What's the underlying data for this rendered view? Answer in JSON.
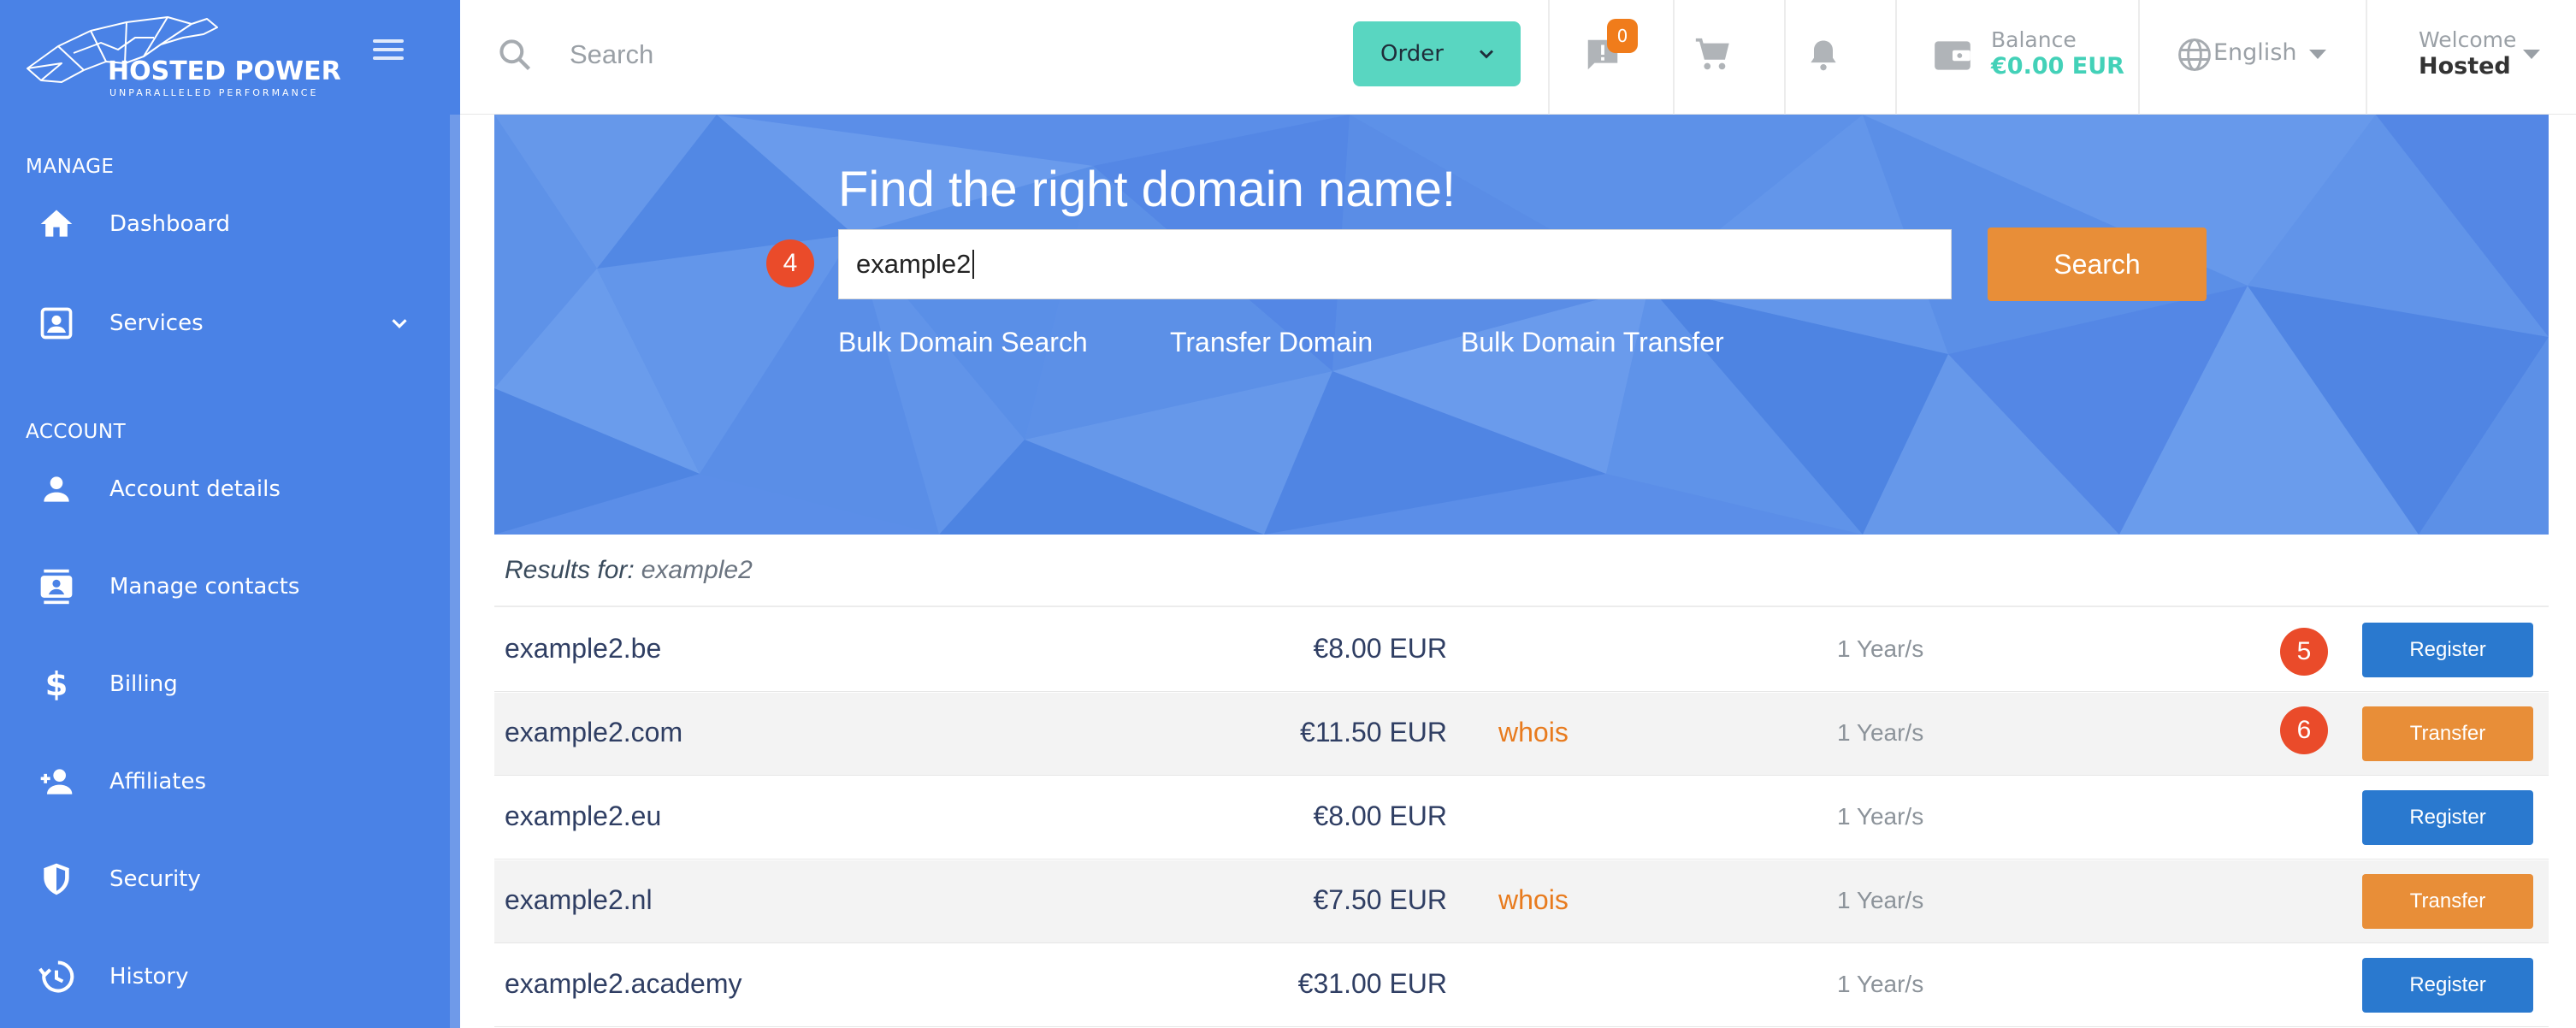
{
  "brand": {
    "name": "HOSTED POWER",
    "tagline": "UNPARALLELED PERFORMANCE"
  },
  "sidebar": {
    "sections": [
      {
        "label": "MANAGE",
        "items": [
          {
            "label": "Dashboard",
            "icon": "home-icon"
          },
          {
            "label": "Services",
            "icon": "services-icon",
            "has_submenu": true
          }
        ]
      },
      {
        "label": "ACCOUNT",
        "items": [
          {
            "label": "Account details",
            "icon": "person-icon"
          },
          {
            "label": "Manage contacts",
            "icon": "contacts-icon"
          },
          {
            "label": "Billing",
            "icon": "dollar-icon"
          },
          {
            "label": "Affiliates",
            "icon": "add-person-icon"
          },
          {
            "label": "Security",
            "icon": "shield-icon"
          },
          {
            "label": "History",
            "icon": "history-icon"
          }
        ]
      }
    ]
  },
  "topbar": {
    "search_placeholder": "Search",
    "order_label": "Order",
    "notification_count": "0",
    "balance_label": "Balance",
    "balance_value": "€0.00 EUR",
    "language": "English",
    "welcome_label": "Welcome",
    "user_name": "Hosted"
  },
  "hero": {
    "title": "Find the right domain name!",
    "query": "example2",
    "search_button": "Search",
    "links": [
      "Bulk Domain Search",
      "Transfer Domain",
      "Bulk Domain Transfer"
    ]
  },
  "markers": [
    "4",
    "5",
    "6"
  ],
  "results": {
    "label": "Results for:",
    "query": "example2",
    "rows": [
      {
        "domain": "example2.be",
        "whois": "",
        "price": "€8.00 EUR",
        "period": "1 Year/s",
        "action": "Register"
      },
      {
        "domain": "example2.com",
        "whois": "whois",
        "price": "€11.50 EUR",
        "period": "1 Year/s",
        "action": "Transfer"
      },
      {
        "domain": "example2.eu",
        "whois": "",
        "price": "€8.00 EUR",
        "period": "1 Year/s",
        "action": "Register"
      },
      {
        "domain": "example2.nl",
        "whois": "whois",
        "price": "€7.50 EUR",
        "period": "1 Year/s",
        "action": "Transfer"
      },
      {
        "domain": "example2.academy",
        "whois": "",
        "price": "€31.00 EUR",
        "period": "1 Year/s",
        "action": "Register"
      }
    ]
  },
  "colors": {
    "sidebar": "#4a82e6",
    "accent_teal": "#59d6c1",
    "register": "#2a79cf",
    "transfer": "#e88e38",
    "marker": "#ea4b2a"
  }
}
